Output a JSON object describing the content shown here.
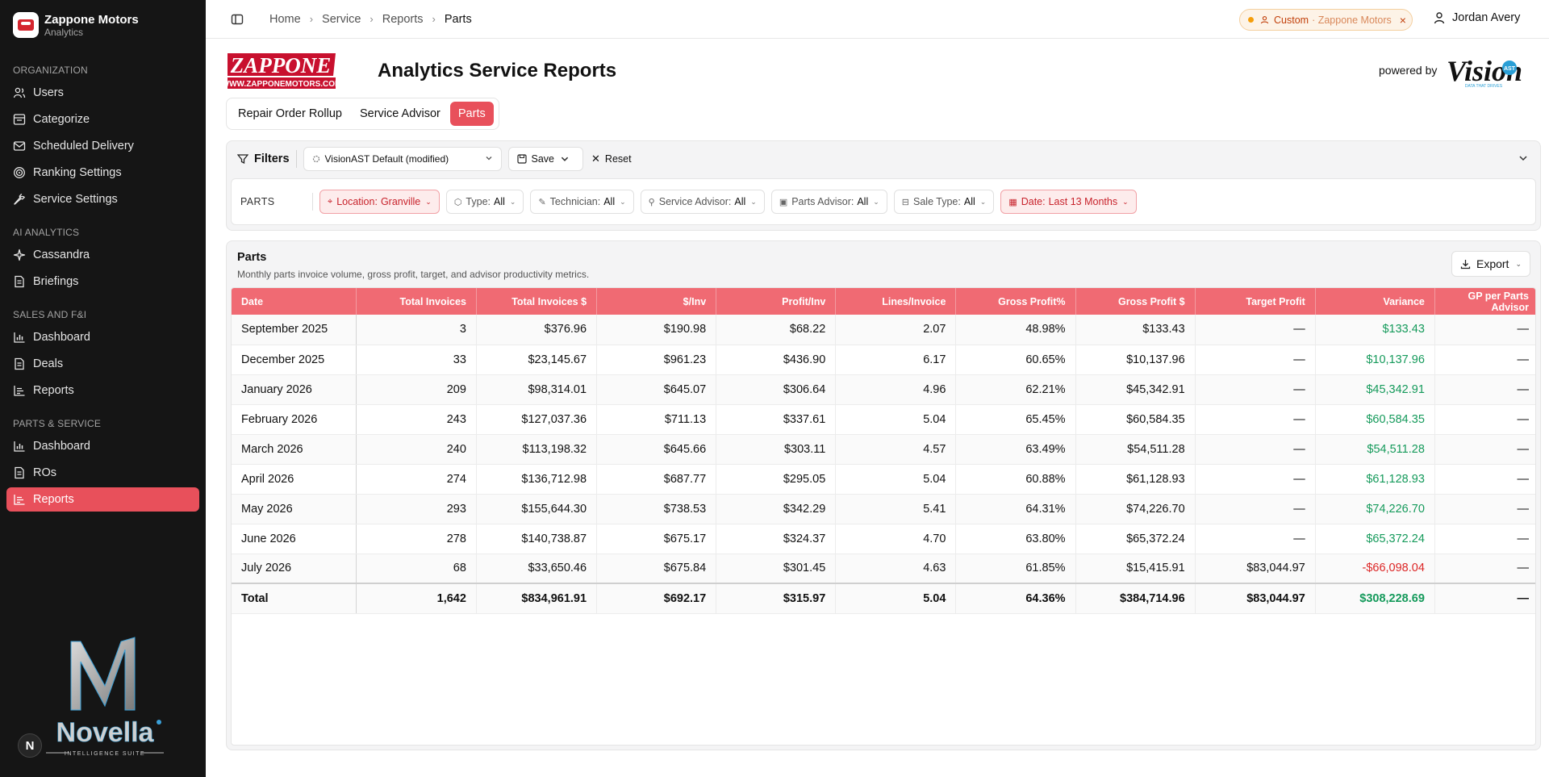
{
  "brand": {
    "name": "Zappone Motors",
    "sub": "Analytics"
  },
  "sidebar": {
    "sections": [
      {
        "title": "ORGANIZATION",
        "items": [
          {
            "label": "Users",
            "icon": "users-icon"
          },
          {
            "label": "Categorize",
            "icon": "categorize-icon"
          },
          {
            "label": "Scheduled Delivery",
            "icon": "mail-icon"
          },
          {
            "label": "Ranking Settings",
            "icon": "target-icon"
          },
          {
            "label": "Service Settings",
            "icon": "wrench-icon"
          }
        ]
      },
      {
        "title": "AI ANALYTICS",
        "items": [
          {
            "label": "Cassandra",
            "icon": "sparkle-icon"
          },
          {
            "label": "Briefings",
            "icon": "document-icon"
          }
        ]
      },
      {
        "title": "SALES AND F&I",
        "items": [
          {
            "label": "Dashboard",
            "icon": "chart-icon"
          },
          {
            "label": "Deals",
            "icon": "document-icon"
          },
          {
            "label": "Reports",
            "icon": "report-icon"
          }
        ]
      },
      {
        "title": "PARTS & SERVICE",
        "items": [
          {
            "label": "Dashboard",
            "icon": "chart-icon"
          },
          {
            "label": "ROs",
            "icon": "document-icon"
          },
          {
            "label": "Reports",
            "icon": "report-icon",
            "active": true
          }
        ]
      }
    ],
    "novella_badge": "N"
  },
  "topbar": {
    "breadcrumbs": [
      "Home",
      "Service",
      "Reports",
      "Parts"
    ],
    "custom_pill": {
      "label": "Custom",
      "sub": "· Zappone Motors"
    },
    "user_name": "Jordan Avery"
  },
  "header": {
    "title": "Analytics Service Reports",
    "powered_by": "powered by"
  },
  "tabs": [
    {
      "label": "Repair Order Rollup",
      "active": false
    },
    {
      "label": "Service Advisor",
      "active": false
    },
    {
      "label": "Parts",
      "active": true
    }
  ],
  "filters": {
    "label": "Filters",
    "preset": "VisionAST Default (modified)",
    "save": "Save",
    "reset": "Reset",
    "section_label": "PARTS",
    "chips": [
      {
        "key": "Location:",
        "value": "Granville",
        "icon": "pin-icon",
        "highlight": true
      },
      {
        "key": "Type:",
        "value": "All",
        "icon": "tag-icon",
        "highlight": false
      },
      {
        "key": "Technician:",
        "value": "All",
        "icon": "wrench-icon",
        "highlight": false
      },
      {
        "key": "Service Advisor:",
        "value": "All",
        "icon": "user-icon",
        "highlight": false
      },
      {
        "key": "Parts Advisor:",
        "value": "All",
        "icon": "box-icon",
        "highlight": false
      },
      {
        "key": "Sale Type:",
        "value": "All",
        "icon": "cart-icon",
        "highlight": false
      },
      {
        "key": "Date:",
        "value": "Last 13 Months",
        "icon": "calendar-icon",
        "highlight": true
      }
    ]
  },
  "parts_card": {
    "title": "Parts",
    "subtitle": "Monthly parts invoice volume, gross profit, target, and advisor productivity metrics.",
    "export": "Export",
    "columns": [
      "Date",
      "Total Invoices",
      "Total Invoices $",
      "$/Inv",
      "Profit/Inv",
      "Lines/Invoice",
      "Gross Profit%",
      "Gross Profit $",
      "Target Profit",
      "Variance",
      "GP per Parts Advisor"
    ],
    "rows": [
      [
        "September 2025",
        "3",
        "$376.96",
        "$190.98",
        "$68.22",
        "2.07",
        "48.98%",
        "$133.43",
        "—",
        "$133.43",
        "—"
      ],
      [
        "December 2025",
        "33",
        "$23,145.67",
        "$961.23",
        "$436.90",
        "6.17",
        "60.65%",
        "$10,137.96",
        "—",
        "$10,137.96",
        "—"
      ],
      [
        "January 2026",
        "209",
        "$98,314.01",
        "$645.07",
        "$306.64",
        "4.96",
        "62.21%",
        "$45,342.91",
        "—",
        "$45,342.91",
        "—"
      ],
      [
        "February 2026",
        "243",
        "$127,037.36",
        "$711.13",
        "$337.61",
        "5.04",
        "65.45%",
        "$60,584.35",
        "—",
        "$60,584.35",
        "—"
      ],
      [
        "March 2026",
        "240",
        "$113,198.32",
        "$645.66",
        "$303.11",
        "4.57",
        "63.49%",
        "$54,511.28",
        "—",
        "$54,511.28",
        "—"
      ],
      [
        "April 2026",
        "274",
        "$136,712.98",
        "$687.77",
        "$295.05",
        "5.04",
        "60.88%",
        "$61,128.93",
        "—",
        "$61,128.93",
        "—"
      ],
      [
        "May 2026",
        "293",
        "$155,644.30",
        "$738.53",
        "$342.29",
        "5.41",
        "64.31%",
        "$74,226.70",
        "—",
        "$74,226.70",
        "—"
      ],
      [
        "June 2026",
        "278",
        "$140,738.87",
        "$675.17",
        "$324.37",
        "4.70",
        "63.80%",
        "$65,372.24",
        "—",
        "$65,372.24",
        "—"
      ],
      [
        "July 2026",
        "68",
        "$33,650.46",
        "$675.84",
        "$301.45",
        "4.63",
        "61.85%",
        "$15,415.91",
        "$83,044.97",
        "-$66,098.04",
        "—"
      ]
    ],
    "total": [
      "Total",
      "1,642",
      "$834,961.91",
      "$692.17",
      "$315.97",
      "5.04",
      "64.36%",
      "$384,714.96",
      "$83,044.97",
      "$308,228.69",
      "—"
    ]
  },
  "colors": {
    "accent": "#e8505b",
    "header": "#f06a73",
    "positive": "#159a5b",
    "negative": "#dc2626"
  }
}
